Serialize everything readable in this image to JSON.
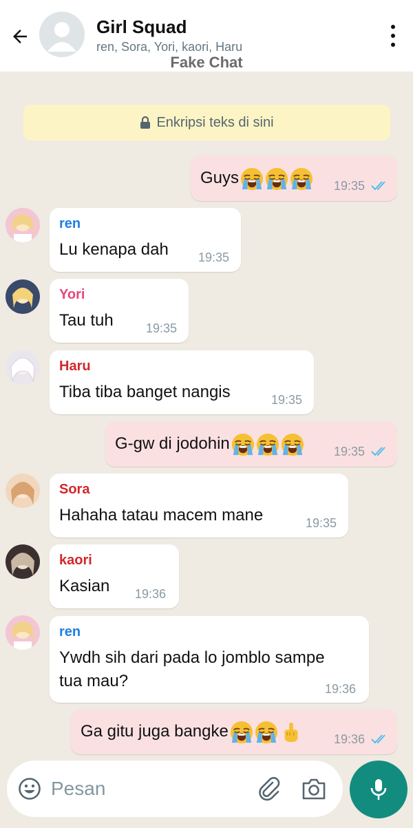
{
  "header": {
    "title": "Girl Squad",
    "members": "ren, Sora, Yori, kaori, Haru",
    "watermark": "Fake Chat"
  },
  "encryption_notice": "Enkripsi teks di sini",
  "messages": [
    {
      "sender": "",
      "text": "Guys",
      "time": "19:35",
      "direction": "out",
      "emojis": [
        "loudly-crying-face",
        "loudly-crying-face",
        "loudly-crying-face"
      ]
    },
    {
      "sender": "ren",
      "text": "Lu kenapa dah",
      "time": "19:35",
      "direction": "in",
      "sender_color": "#1d7fe0"
    },
    {
      "sender": "Yori",
      "text": "Tau tuh",
      "time": "19:35",
      "direction": "in",
      "sender_color": "#e8467a"
    },
    {
      "sender": "Haru",
      "text": "Tiba tiba banget nangis",
      "time": "19:35",
      "direction": "in",
      "sender_color": "#d3262b"
    },
    {
      "sender": "",
      "text": "G-gw di jodohin",
      "time": "19:35",
      "direction": "out",
      "emojis": [
        "loudly-crying-face",
        "loudly-crying-face",
        "loudly-crying-face"
      ]
    },
    {
      "sender": "Sora",
      "text": "Hahaha tatau macem mane",
      "time": "19:35",
      "direction": "in",
      "sender_color": "#d3262b"
    },
    {
      "sender": "kaori",
      "text": "Kasian",
      "time": "19:36",
      "direction": "in",
      "sender_color": "#d3262b"
    },
    {
      "sender": "ren",
      "text_line1": "Ywdh sih dari pada lo jomblo sampe",
      "text_line2": "tua mau?",
      "time": "19:36",
      "direction": "in",
      "sender_color": "#1d7fe0"
    },
    {
      "sender": "",
      "text": "Ga gitu juga bangke",
      "time": "19:36",
      "direction": "out",
      "emojis": [
        "loudly-crying-face",
        "loudly-crying-face",
        "middle-finger"
      ]
    }
  ],
  "input": {
    "placeholder": "Pesan"
  },
  "colors": {
    "background": "#efeae2",
    "outgoing_bubble": "#fbe0e2",
    "incoming_bubble": "#ffffff",
    "read_ticks": "#53bdeb",
    "mic_button": "#128c7e",
    "encryption_banner": "#fdf4c5"
  },
  "icons": [
    "back-arrow-icon",
    "group-avatar-icon",
    "more-vert-icon",
    "lock-icon",
    "double-check-icon",
    "emoji-icon",
    "paperclip-icon",
    "camera-icon",
    "mic-icon"
  ]
}
